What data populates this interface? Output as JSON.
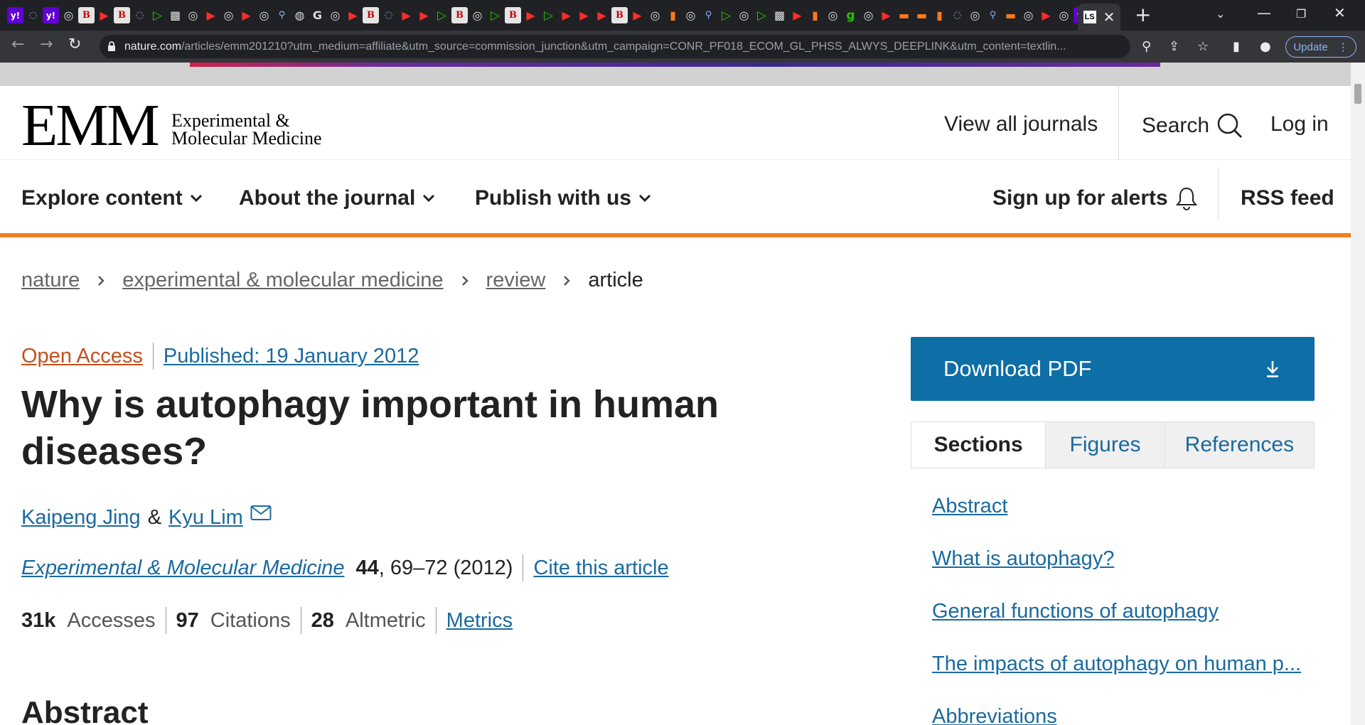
{
  "browser": {
    "tab_favicon_text": "LS",
    "tab_favicons": [
      "y!",
      "◌",
      "y!",
      "◎",
      "B",
      "▶",
      "B",
      "◌",
      "▷",
      "▩",
      "◎",
      "▶",
      "◎",
      "▶",
      "◎",
      "⚲",
      "◍",
      "G",
      "◎",
      "▶",
      "B",
      "◌",
      "▶",
      "▶",
      "▷",
      "B",
      "◎",
      "▷",
      "B",
      "▶",
      "▷",
      "▶",
      "▶",
      "▶",
      "B",
      "▶",
      "◎",
      "▮",
      "◎",
      "⚲",
      "▷",
      "◎",
      "▷",
      "▩",
      "▶",
      "▮",
      "◎",
      "g",
      "◎",
      "▶",
      "▬",
      "▬",
      "▮",
      "◌",
      "◎",
      "⚲",
      "▬",
      "◎",
      "▶",
      "◎",
      "y!"
    ],
    "url_host": "nature.com",
    "url_rest": "/articles/emm201210?utm_medium=affiliate&utm_source=commission_junction&utm_campaign=CONR_PF018_ECOM_GL_PHSS_ALWYS_DEEPLINK&utm_content=textlin...",
    "update_label": "Update",
    "close_glyph": "✕",
    "newtab_glyph": "+",
    "icons": [
      "back-icon",
      "forward-icon",
      "reload-icon",
      "lock-icon",
      "zoom-icon",
      "share-icon",
      "star-icon",
      "sidepanel-icon",
      "profile-icon",
      "menu-icon"
    ]
  },
  "header": {
    "logo_main": "EMM",
    "logo_line1": "Experimental &",
    "logo_line2": "Molecular Medicine",
    "view_all_journals": "View all journals",
    "search": "Search",
    "login": "Log in"
  },
  "nav": {
    "explore": "Explore content",
    "about": "About the journal",
    "publish": "Publish with us",
    "alerts": "Sign up for alerts",
    "rss": "RSS feed"
  },
  "breadcrumb": [
    "nature",
    "experimental & molecular medicine",
    "review",
    "article"
  ],
  "article": {
    "open_access": "Open Access",
    "published": "Published: 19 January 2012",
    "title": "Why is autophagy important in human diseases?",
    "author1": "Kaipeng Jing",
    "amp": "&",
    "author2": "Kyu Lim",
    "journal": "Experimental & Molecular Medicine",
    "volume": "44",
    "pages": ", 69–72 (2012)",
    "cite": "Cite this article",
    "accesses_value": "31k",
    "accesses_label": "Accesses",
    "citations_value": "97",
    "citations_label": "Citations",
    "altmetric_value": "28",
    "altmetric_label": "Altmetric",
    "metrics_link": "Metrics",
    "abstract_heading": "Abstract"
  },
  "sidebar": {
    "download": "Download PDF",
    "tabs": [
      "Sections",
      "Figures",
      "References"
    ],
    "sections": [
      "Abstract",
      "What is autophagy?",
      "General functions of autophagy",
      "The impacts of autophagy on human p...",
      "Abbreviations"
    ]
  },
  "colors": {
    "brand_orange": "#f07e20",
    "link_blue": "#1a6aa0",
    "button_blue": "#0e6ea6",
    "open_access": "#c4501e"
  }
}
